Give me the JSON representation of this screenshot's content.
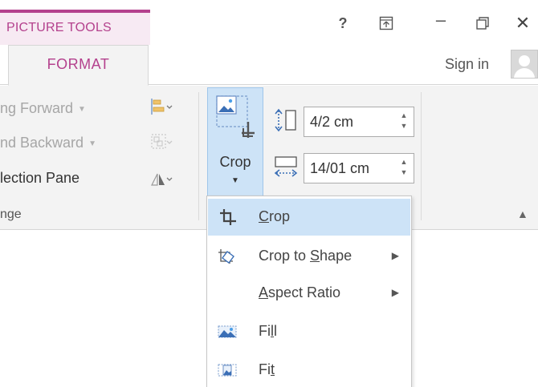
{
  "context_group": {
    "label": "PICTURE TOOLS"
  },
  "window": {
    "help": "?",
    "minimize": "–",
    "close": "✕"
  },
  "tabs": {
    "format": "FORMAT",
    "sign_in": "Sign in"
  },
  "arrange": {
    "bring_forward": "ng Forward",
    "send_backward": "nd Backward",
    "selection_pane": "lection Pane",
    "group_label": "nge"
  },
  "crop": {
    "label": "Crop"
  },
  "size": {
    "height": "4/2 cm",
    "width": "14/01 cm"
  },
  "crop_menu": {
    "items": [
      {
        "pre": "",
        "key": "C",
        "post": "rop",
        "submenu": false
      },
      {
        "pre": "Crop to ",
        "key": "S",
        "post": "hape",
        "submenu": true
      },
      {
        "pre": "",
        "key": "A",
        "post": "spect Ratio",
        "submenu": true
      },
      {
        "pre": "Fi",
        "key": "l",
        "post": "l",
        "submenu": false
      },
      {
        "pre": "Fi",
        "key": "t",
        "post": "",
        "submenu": false
      }
    ]
  },
  "colors": {
    "accent": "#b4418d",
    "context_bg": "#f7eaf3",
    "highlight": "#cde3f7",
    "ribbon_bg": "#f3f3f3"
  },
  "icons": {
    "help": "help-icon",
    "ribbon_display": "ribbon-display-options-icon",
    "minimize": "minimize-icon",
    "restore": "restore-icon",
    "close": "close-icon",
    "crop": "crop-icon",
    "crop_to_shape": "crop-to-shape-icon",
    "fill": "fill-icon",
    "fit": "fit-icon"
  }
}
